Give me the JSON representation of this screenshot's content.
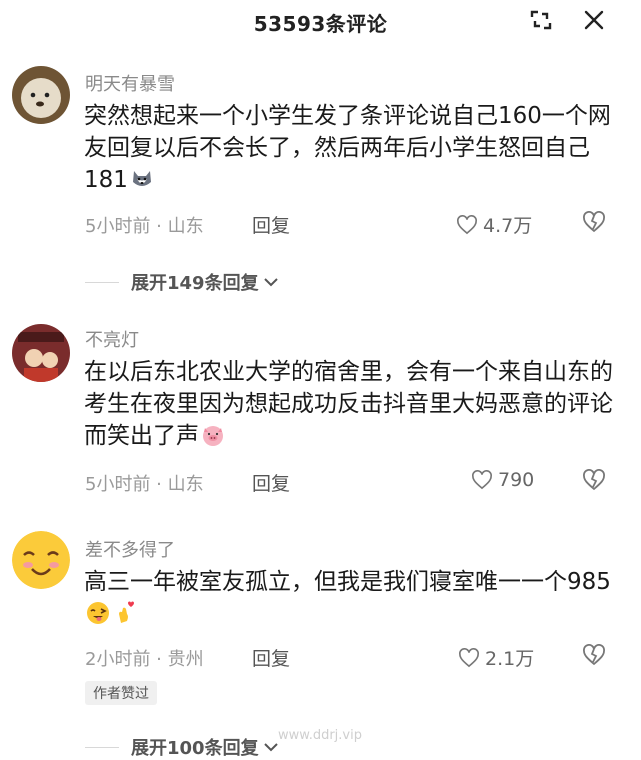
{
  "header": {
    "title": "53593条评论"
  },
  "comments": [
    {
      "username": "明天有暴雪",
      "text": "突然想起来一个小学生发了条评论说自己160一个网友回复以后不会长了，然后两年后小学生怒回自己181",
      "time_location": "5小时前 · 山东",
      "reply_label": "回复",
      "likes": "4.7万",
      "expand_label": "展开149条回复"
    },
    {
      "username": "不亮灯",
      "text": "在以后东北农业大学的宿舍里，会有一个来自山东的考生在夜里因为想起成功反击抖音里大妈恶意的评论而笑出了声",
      "time_location": "5小时前 · 山东",
      "reply_label": "回复",
      "likes": "790"
    },
    {
      "username": "差不多得了",
      "text": "高三一年被室友孤立，但我是我们寝室唯一一个985",
      "time_location": "2小时前 · 贵州",
      "reply_label": "回复",
      "likes": "2.1万",
      "badge": "作者赞过",
      "expand_label": "展开100条回复"
    }
  ],
  "watermark": "www.ddrj.vip"
}
